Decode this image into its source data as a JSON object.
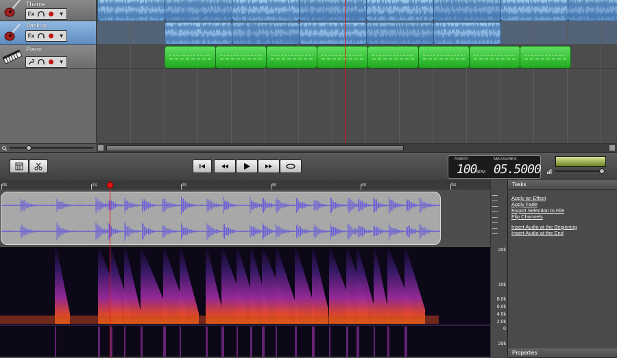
{
  "tracks": [
    {
      "name": "Theme",
      "icon": "guitar-icon"
    },
    {
      "name": "Backup",
      "icon": "guitar-icon"
    },
    {
      "name": "Piano",
      "icon": "keyboard-icon"
    }
  ],
  "track_controls": {
    "fx": "Fx",
    "menu": "▼"
  },
  "transport": {
    "tempo_label": "TEMPO",
    "tempo_value": "100",
    "tempo_unit": "BPM",
    "measures_label": "MEASURES",
    "measures_value": "05.5000"
  },
  "ruler": [
    "0s",
    "1s",
    "2s",
    "3s",
    "4s",
    "5s"
  ],
  "freq_labels": [
    "20k",
    "10k",
    "8.0k",
    "6.0k",
    "4.0k",
    "2.0k",
    "0",
    "20k"
  ],
  "tasks": {
    "title": "Tasks",
    "items": [
      "Apply an Effect",
      "Apply Fade",
      "Export Selection to File",
      "Flip Channels",
      "Insert Audio at the Beginning",
      "Insert Audio at the End"
    ]
  },
  "properties": {
    "title": "Properties"
  },
  "colors": {
    "selected_track": "#6f9fd2",
    "audio_clip": "#8fbbe4",
    "midi_clip": "#2fc02f",
    "playhead": "#e01515",
    "waveform": "#6a5fd8"
  }
}
